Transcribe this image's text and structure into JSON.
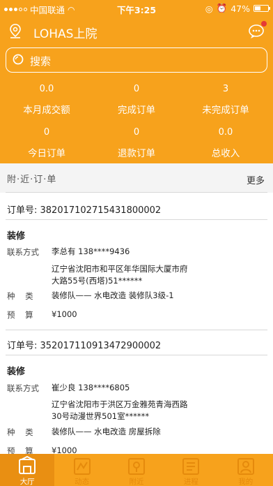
{
  "status_bar": {
    "carrier": "中国联通",
    "time": "下午3:25",
    "battery": "47%"
  },
  "header": {
    "title": "LOHAS上院"
  },
  "search": {
    "placeholder": "搜索"
  },
  "stats": [
    {
      "value": "0.0",
      "label": "本月成交额"
    },
    {
      "value": "0",
      "label": "完成订单"
    },
    {
      "value": "3",
      "label": "未完成订单"
    },
    {
      "value": "0",
      "label": "今日订单"
    },
    {
      "value": "0",
      "label": "退款订单"
    },
    {
      "value": "0.0",
      "label": "总收入"
    }
  ],
  "nearby": {
    "title": "附·近·订·单",
    "more": "更多"
  },
  "orders": [
    {
      "order_no": "订单号: 382017102715431800002",
      "category": "装修",
      "contact_label": "联系方式",
      "contact": "李总有   138****9436",
      "address_line1": "辽宁省沈阳市和平区年华国际大厦市府",
      "address_line2": "大路55号(西塔)51******",
      "type_label": "种    类",
      "type": "装修队—— 水电改造 装修队3级-1",
      "budget_label": "预    算",
      "budget": "¥1000"
    },
    {
      "order_no": "订单号: 352017110913472900002",
      "category": "装修",
      "contact_label": "联系方式",
      "contact": "崔少良   138****6805",
      "address_line1": "辽宁省沈阳市于洪区万金雅苑青海西路",
      "address_line2": "30号动漫世界501室******",
      "type_label": "种    类",
      "type": "装修队—— 水电改造 房屋拆除",
      "budget_label": "预    算",
      "budget": "¥1000"
    }
  ],
  "tabs": [
    {
      "label": "大厅",
      "icon": "hall-icon",
      "active": true
    },
    {
      "label": "动态",
      "icon": "activity-icon",
      "active": false
    },
    {
      "label": "附近",
      "icon": "nearby-icon",
      "active": false
    },
    {
      "label": "进程",
      "icon": "progress-icon",
      "active": false
    },
    {
      "label": "我的",
      "icon": "profile-icon",
      "active": false
    }
  ],
  "colors": {
    "brand": "#f7a21c",
    "active_tab": "#e98f12"
  }
}
